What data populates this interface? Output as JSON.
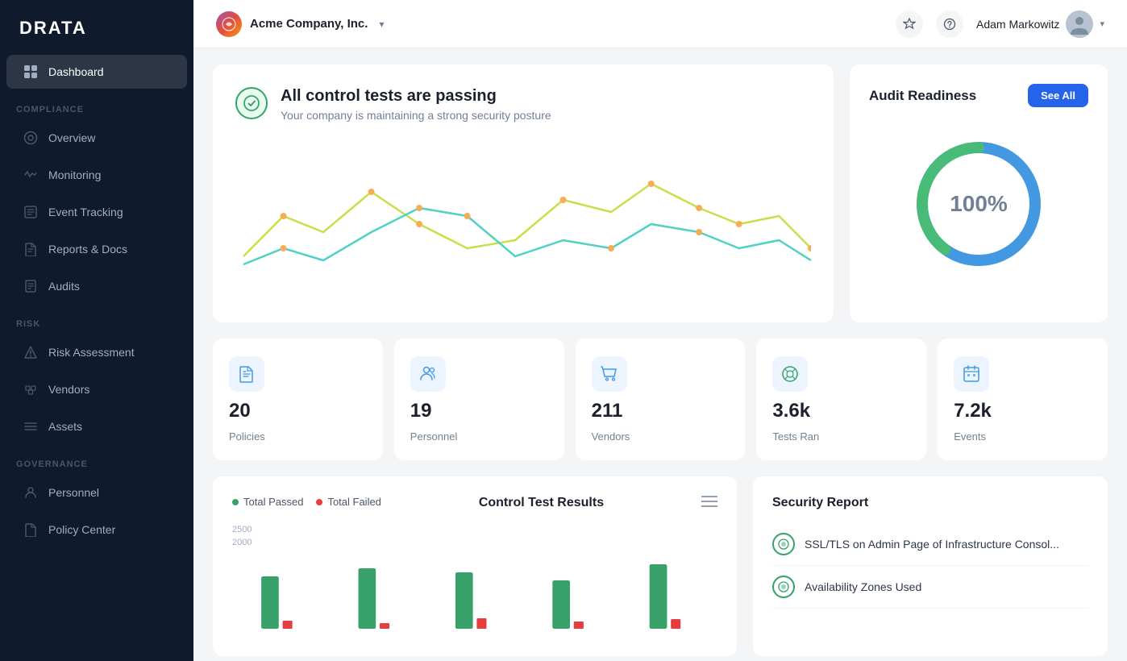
{
  "sidebar": {
    "logo": "DRATA",
    "sections": [
      {
        "label": "",
        "items": [
          {
            "id": "dashboard",
            "label": "Dashboard",
            "active": true,
            "icon": "⊞"
          }
        ]
      },
      {
        "label": "COMPLIANCE",
        "items": [
          {
            "id": "overview",
            "label": "Overview",
            "active": false,
            "icon": "○"
          },
          {
            "id": "monitoring",
            "label": "Monitoring",
            "active": false,
            "icon": "△"
          },
          {
            "id": "event-tracking",
            "label": "Event Tracking",
            "active": false,
            "icon": "□"
          },
          {
            "id": "reports-docs",
            "label": "Reports & Docs",
            "active": false,
            "icon": "📄"
          },
          {
            "id": "audits",
            "label": "Audits",
            "active": false,
            "icon": "📋"
          }
        ]
      },
      {
        "label": "RISK",
        "items": [
          {
            "id": "risk-assessment",
            "label": "Risk Assessment",
            "active": false,
            "icon": "⚠"
          },
          {
            "id": "vendors",
            "label": "Vendors",
            "active": false,
            "icon": "◈"
          },
          {
            "id": "assets",
            "label": "Assets",
            "active": false,
            "icon": "≡"
          }
        ]
      },
      {
        "label": "GOVERNANCE",
        "items": [
          {
            "id": "personnel",
            "label": "Personnel",
            "active": false,
            "icon": "👤"
          },
          {
            "id": "policy-center",
            "label": "Policy Center",
            "active": false,
            "icon": "📄"
          }
        ]
      }
    ]
  },
  "header": {
    "company_logo_alt": "Acme Company Logo",
    "company_name": "Acme Company, Inc.",
    "user_name": "Adam Markowitz",
    "chevron": "▾"
  },
  "control_tests": {
    "title": "All control tests are passing",
    "subtitle": "Your company is maintaining a strong security posture"
  },
  "audit_readiness": {
    "title": "Audit Readiness",
    "see_all_label": "See All",
    "percentage": "100%"
  },
  "stats": [
    {
      "id": "policies",
      "value": "20",
      "label": "Policies"
    },
    {
      "id": "personnel",
      "value": "19",
      "label": "Personnel"
    },
    {
      "id": "vendors",
      "value": "211",
      "label": "Vendors"
    },
    {
      "id": "tests-ran",
      "value": "3.6k",
      "label": "Tests Ran"
    },
    {
      "id": "events",
      "value": "7.2k",
      "label": "Events"
    }
  ],
  "control_results": {
    "title": "Control Test Results",
    "legend": [
      {
        "label": "Total Passed",
        "color": "#38a169"
      },
      {
        "label": "Total Failed",
        "color": "#e53e3e"
      }
    ],
    "y_labels": [
      "2500",
      "2000"
    ],
    "bar_data": [
      {
        "x": 0,
        "passed": 60,
        "failed": 5
      },
      {
        "x": 1,
        "passed": 75,
        "failed": 3
      },
      {
        "x": 2,
        "passed": 80,
        "failed": 8
      },
      {
        "x": 3,
        "passed": 70,
        "failed": 4
      },
      {
        "x": 4,
        "passed": 90,
        "failed": 6
      }
    ]
  },
  "security_report": {
    "title": "Security Report",
    "items": [
      {
        "label": "SSL/TLS on Admin Page of Infrastructure Consol..."
      },
      {
        "label": "Availability Zones Used"
      }
    ]
  }
}
